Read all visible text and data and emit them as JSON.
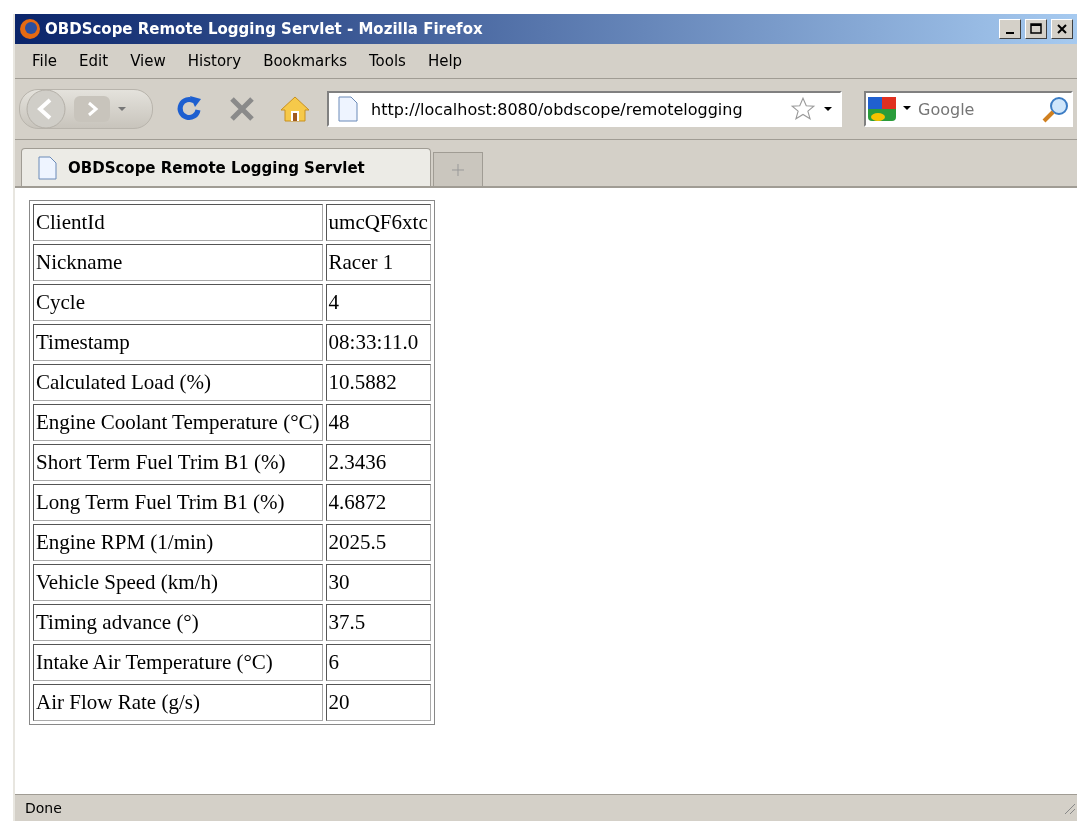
{
  "window": {
    "title": "OBDScope Remote Logging Servlet - Mozilla Firefox"
  },
  "menu": [
    "File",
    "Edit",
    "View",
    "History",
    "Bookmarks",
    "Tools",
    "Help"
  ],
  "address_bar": {
    "value": "http://localhost:8080/obdscope/remotelogging"
  },
  "search": {
    "placeholder": "Google"
  },
  "tabs": [
    {
      "label": "OBDScope Remote Logging Servlet",
      "selected": true
    }
  ],
  "table": {
    "rows": [
      {
        "label": "ClientId",
        "value": "umcQF6xtc"
      },
      {
        "label": "Nickname",
        "value": "Racer 1"
      },
      {
        "label": "Cycle",
        "value": "4"
      },
      {
        "label": "Timestamp",
        "value": "08:33:11.0"
      },
      {
        "label": "Calculated Load (%)",
        "value": "10.5882"
      },
      {
        "label": "Engine Coolant Temperature (°C)",
        "value": "48"
      },
      {
        "label": "Short Term Fuel Trim B1 (%)",
        "value": "2.3436"
      },
      {
        "label": "Long Term Fuel Trim B1 (%)",
        "value": "4.6872"
      },
      {
        "label": "Engine RPM (1/min)",
        "value": "2025.5"
      },
      {
        "label": "Vehicle Speed (km/h)",
        "value": "30"
      },
      {
        "label": "Timing advance (°)",
        "value": "37.5"
      },
      {
        "label": "Intake Air Temperature (°C)",
        "value": "6"
      },
      {
        "label": "Air Flow Rate (g/s)",
        "value": "20"
      }
    ]
  },
  "status_bar": "Done"
}
